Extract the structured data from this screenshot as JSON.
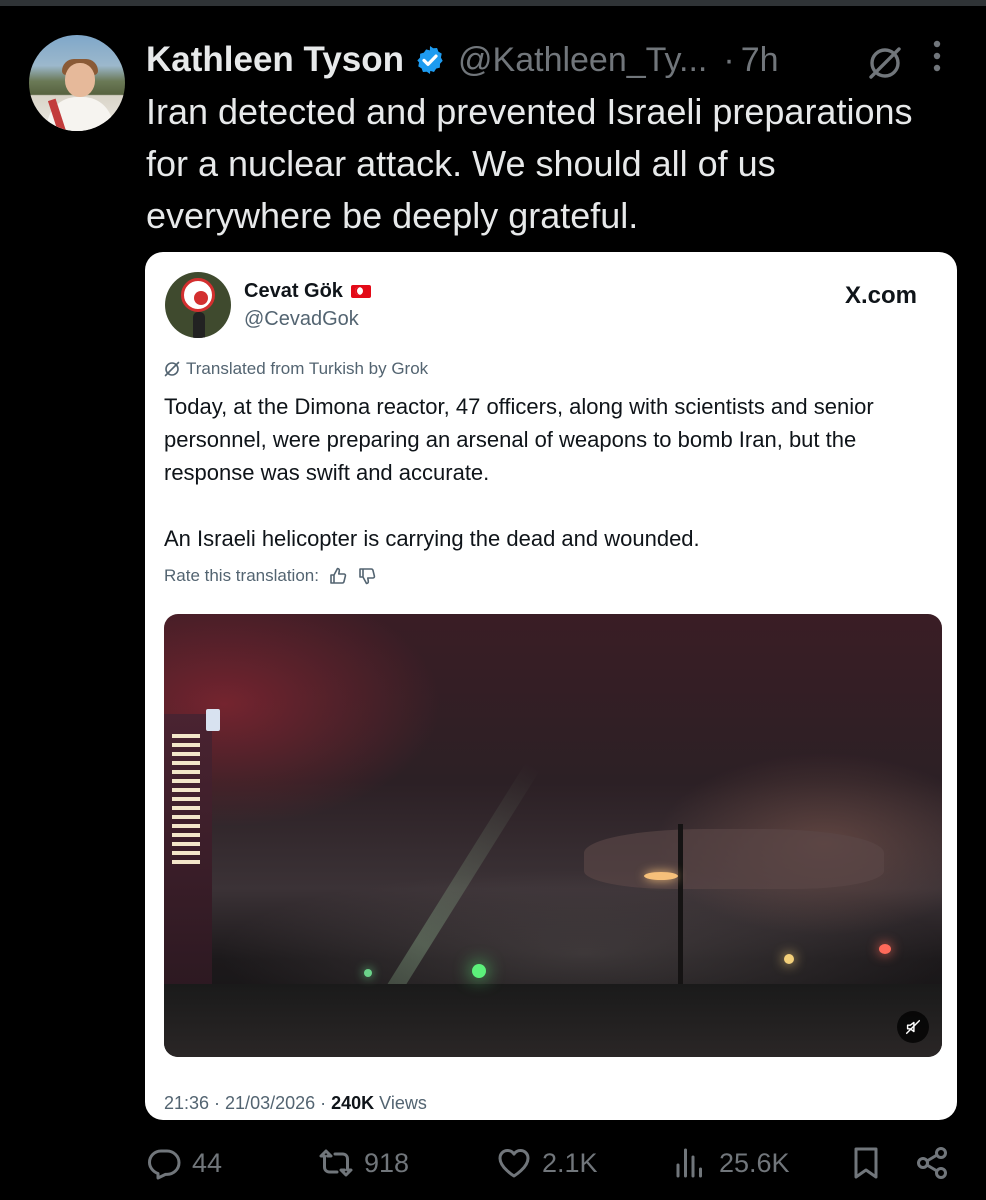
{
  "post": {
    "author_name": "Kathleen Tyson",
    "author_handle": "@Kathleen_Ty...",
    "separator": "·",
    "time": "7h",
    "text": "Iran detected and prevented Israeli preparations for a nuclear attack. We should all of us everywhere be deeply grateful."
  },
  "quoted": {
    "author_name": "Cevat Gök",
    "author_handle": "@CevadGok",
    "source": "X.com",
    "translated_label": "Translated from Turkish by Grok",
    "paragraphs": [
      "Today, at the Dimona reactor, 47 officers, along with scientists and senior personnel, were preparing an arsenal of weapons to bomb Iran, but the response was swift and accurate.",
      "An Israeli helicopter is carrying the dead and wounded."
    ],
    "rate_label": "Rate this translation:",
    "timestamp": "21:36 · 21/03/2026 · ",
    "views_count": "240K",
    "views_label": " Views"
  },
  "actions": {
    "replies": "44",
    "reposts": "918",
    "likes": "2.1K",
    "views": "25.6K"
  },
  "colors": {
    "background": "#000000",
    "text_primary": "#e7e9ea",
    "text_secondary": "#71767b",
    "verified": "#1d9bf0",
    "card_background": "#ffffff",
    "card_text": "#0f1419"
  },
  "icons": [
    "verified-badge-icon",
    "grok-icon",
    "more-icon",
    "flag-tr-icon",
    "thumbs-up-icon",
    "thumbs-down-icon",
    "mute-icon",
    "reply-icon",
    "repost-icon",
    "like-icon",
    "views-icon",
    "bookmark-icon",
    "share-icon"
  ]
}
